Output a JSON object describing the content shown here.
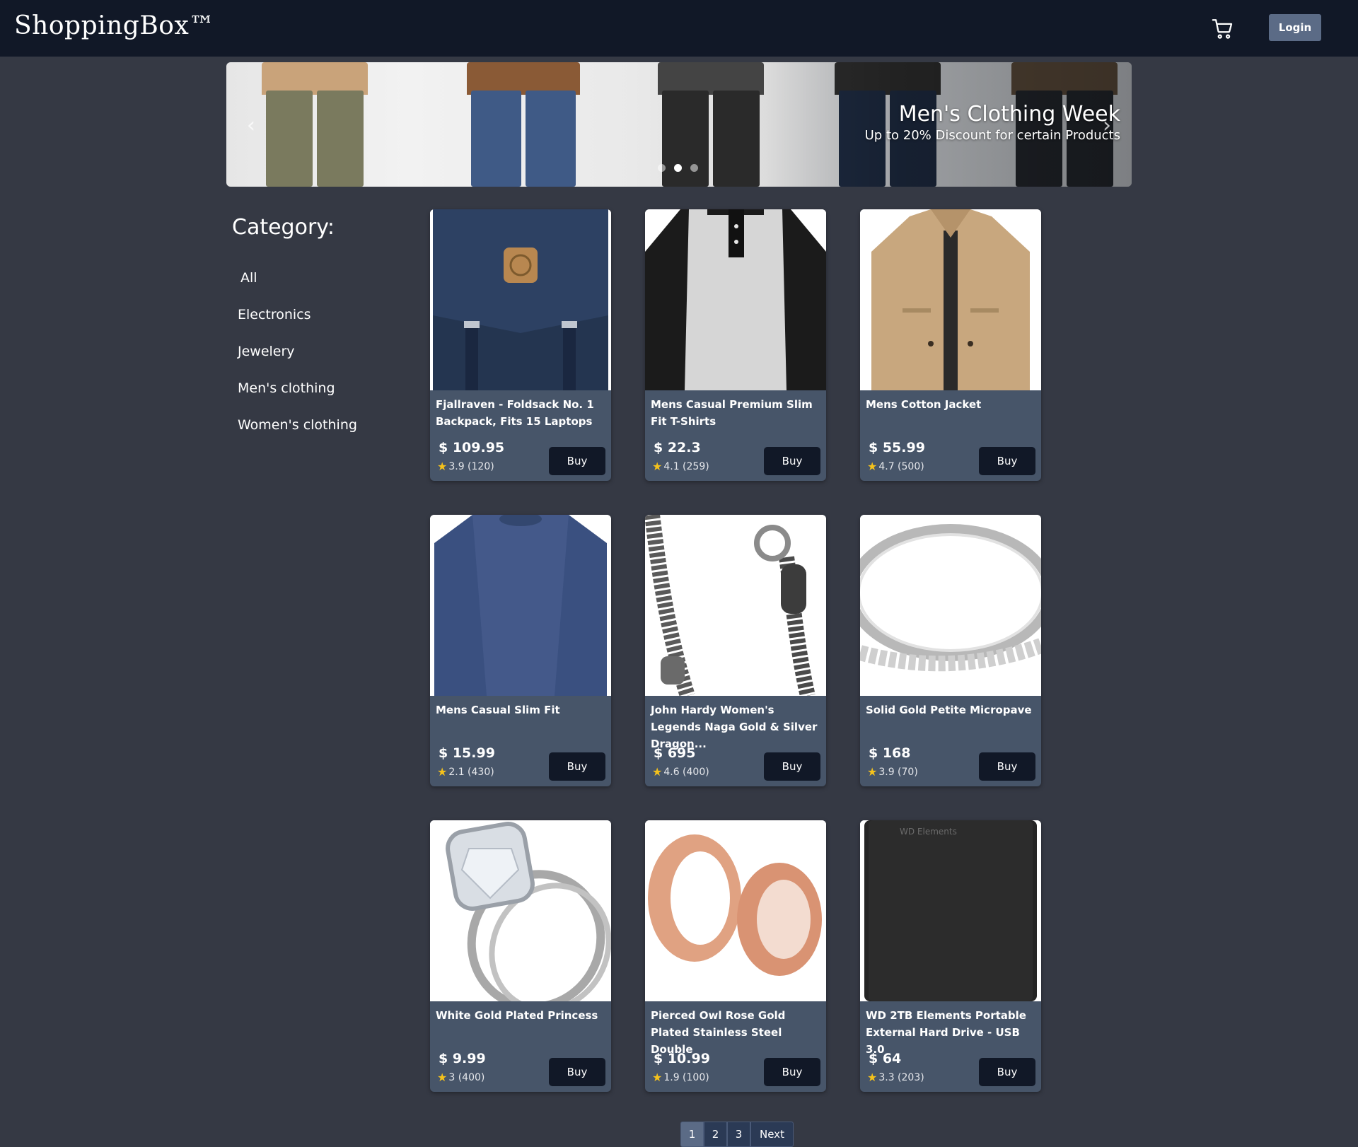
{
  "header": {
    "brand": "ShoppingBox™",
    "login_label": "Login"
  },
  "carousel": {
    "title": "Men's Clothing Week",
    "subtitle": "Up to 20% Discount for certain Products",
    "prev_glyph": "‹",
    "next_glyph": "›",
    "slide_count": 3,
    "active_slide": 2
  },
  "sidebar": {
    "title": "Category:",
    "items": [
      {
        "label": "All"
      },
      {
        "label": "Electronics"
      },
      {
        "label": "Jewelery"
      },
      {
        "label": "Men's clothing"
      },
      {
        "label": "Women's clothing"
      }
    ]
  },
  "products": [
    {
      "name": "Fjallraven - Foldsack No. 1 Backpack, Fits 15 Laptops",
      "price": "$ 109.95",
      "rating": "3.9 (120)",
      "buy_label": "Buy",
      "image": "backpack"
    },
    {
      "name": "Mens Casual Premium Slim Fit T-Shirts",
      "price": "$ 22.3",
      "rating": "4.1 (259)",
      "buy_label": "Buy",
      "image": "tshirt"
    },
    {
      "name": "Mens Cotton Jacket",
      "price": "$ 55.99",
      "rating": "4.7 (500)",
      "buy_label": "Buy",
      "image": "jacket"
    },
    {
      "name": "Mens Casual Slim Fit",
      "price": "$ 15.99",
      "rating": "2.1 (430)",
      "buy_label": "Buy",
      "image": "longsleeve"
    },
    {
      "name": "John Hardy Women's Legends Naga Gold & Silver Dragon...",
      "price": "$ 695",
      "rating": "4.6 (400)",
      "buy_label": "Buy",
      "image": "bracelet"
    },
    {
      "name": "Solid Gold Petite Micropave",
      "price": "$ 168",
      "rating": "3.9 (70)",
      "buy_label": "Buy",
      "image": "ring-band"
    },
    {
      "name": "White Gold Plated Princess",
      "price": "$ 9.99",
      "rating": "3 (400)",
      "buy_label": "Buy",
      "image": "ring-diamond"
    },
    {
      "name": "Pierced Owl Rose Gold Plated Stainless Steel Double",
      "price": "$ 10.99",
      "rating": "1.9 (100)",
      "buy_label": "Buy",
      "image": "rose-gold-plugs"
    },
    {
      "name": "WD 2TB Elements Portable External Hard Drive - USB 3.0",
      "price": "$ 64",
      "rating": "3.3 (203)",
      "buy_label": "Buy",
      "image": "hard-drive",
      "image_text": "WD Elements"
    }
  ],
  "pagination": {
    "pages": [
      "1",
      "2",
      "3"
    ],
    "active": "1",
    "next_label": "Next"
  },
  "icons": {
    "cart": "cart-icon",
    "star": "star-icon"
  },
  "colors": {
    "nav_bg": "#111827",
    "page_bg": "#353944",
    "card_bg": "#475569",
    "button_bg": "#111827",
    "login_bg": "#5b6b86",
    "star": "#f5c21b"
  }
}
